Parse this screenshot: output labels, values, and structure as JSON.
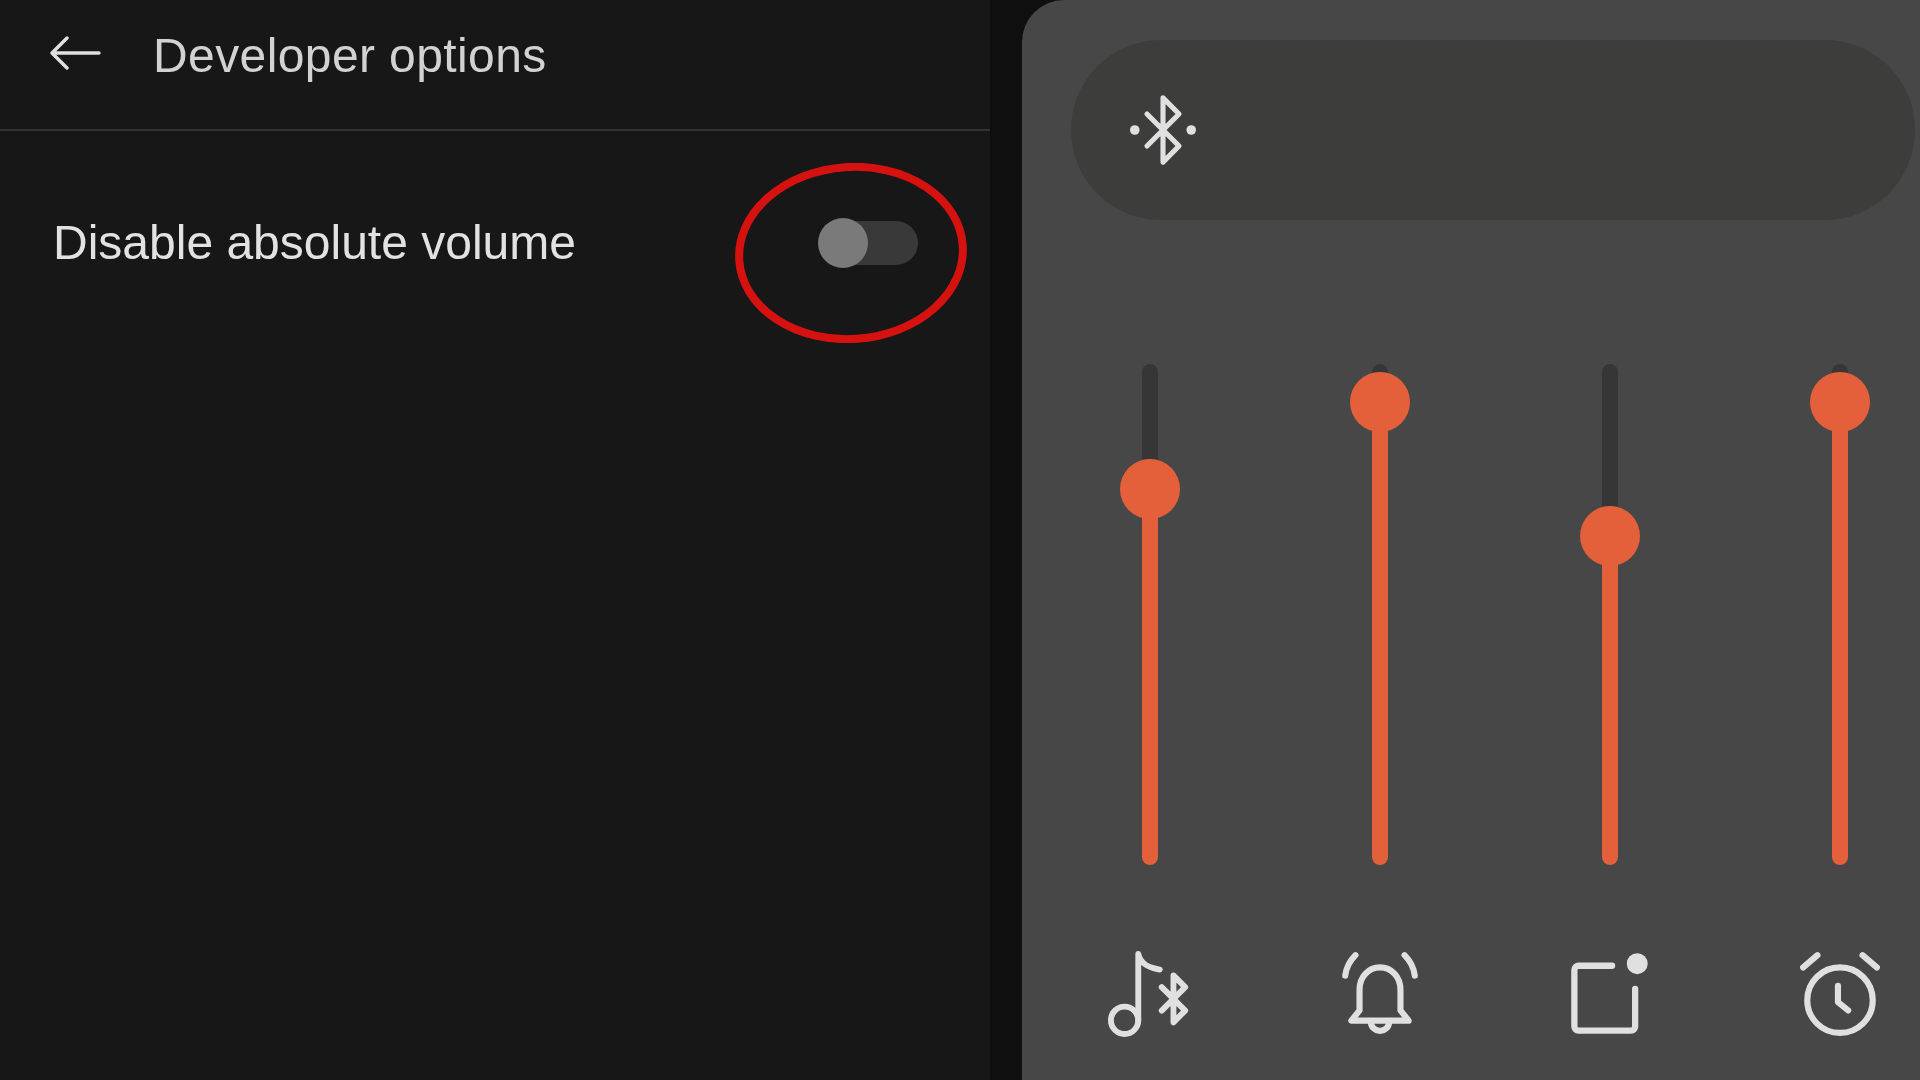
{
  "header": {
    "title": "Developer options"
  },
  "settings": [
    {
      "label": "Disable absolute volume",
      "on": false,
      "highlighted": true
    }
  ],
  "volume_panel": {
    "sliders": [
      {
        "kind": "media",
        "level": 0.8
      },
      {
        "kind": "ring",
        "level": 1
      },
      {
        "kind": "notification",
        "level": 0.69
      },
      {
        "kind": "alarm",
        "level": 1
      }
    ]
  }
}
